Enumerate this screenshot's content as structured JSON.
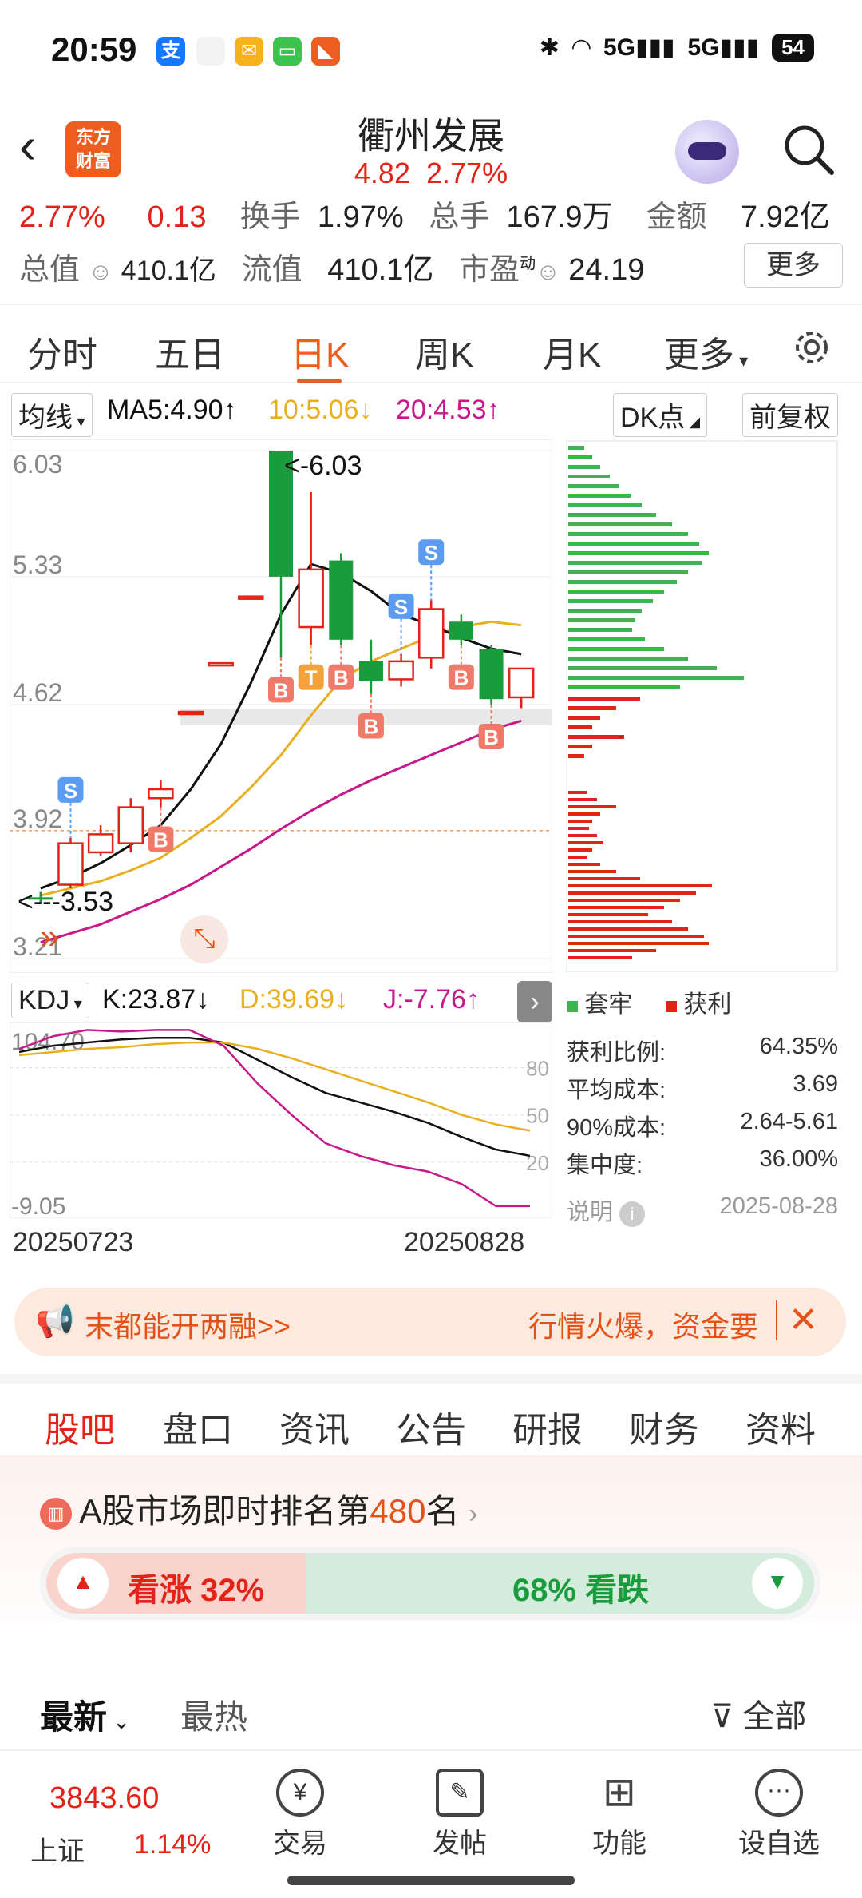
{
  "status_bar": {
    "time": "20:59",
    "network": "5G",
    "battery": "54"
  },
  "header": {
    "stock_name": "衢州发展",
    "price": "4.82",
    "change_pct": "2.77%"
  },
  "quote": {
    "row1": {
      "change_pct": "2.77%",
      "change": "0.13",
      "turnover_label": "换手",
      "turnover": "1.97%",
      "volume_label": "总手",
      "volume": "167.9万",
      "amount_label": "金额",
      "amount": "7.92亿"
    },
    "row2": {
      "total_cap_label": "总值",
      "total_cap": "410.1亿",
      "float_cap_label": "流值",
      "float_cap": "410.1亿",
      "pe_label": "市盈",
      "pe_sup": "动",
      "pe": "24.19"
    },
    "more_button": "更多"
  },
  "chart_tabs": [
    "分时",
    "五日",
    "日K",
    "周K",
    "月K",
    "更多"
  ],
  "chart_settings_icon": "gear-icon",
  "ma": {
    "label": "均线",
    "ma5": "MA5:4.90",
    "ma10": "10:5.06",
    "ma20": "20:4.53",
    "dk": "DK点",
    "adjust": "前复权"
  },
  "kdj": {
    "label": "KDJ",
    "k": "K:23.87",
    "d": "D:39.69",
    "j": "J:-7.76"
  },
  "colors": {
    "up": "#e2231a",
    "down": "#1a9c3c",
    "accent": "#ee5d20",
    "ma5": "#111111",
    "ma10": "#e8b020",
    "ma20": "#c8198a"
  },
  "chart_data": [
    {
      "type": "candlestick",
      "y_labels": [
        "6.03",
        "5.33",
        "4.62",
        "3.92",
        "3.21"
      ],
      "ylim": [
        3.21,
        6.03
      ],
      "annotations": {
        "high": "<-6.03",
        "low": "<---3.53"
      },
      "start_date": "20250723",
      "end_date": "20250828",
      "candles": [
        {
          "o": 3.55,
          "c": 3.55,
          "h": 3.58,
          "l": 3.52,
          "up": false
        },
        {
          "o": 3.62,
          "c": 3.85,
          "h": 3.88,
          "l": 3.6,
          "up": true
        },
        {
          "o": 3.8,
          "c": 3.9,
          "h": 3.95,
          "l": 3.78,
          "up": true
        },
        {
          "o": 3.85,
          "c": 4.05,
          "h": 4.1,
          "l": 3.8,
          "up": true
        },
        {
          "o": 4.1,
          "c": 4.15,
          "h": 4.2,
          "l": 4.05,
          "up": true
        },
        {
          "o": 4.58,
          "c": 4.58,
          "h": 4.58,
          "l": 4.58,
          "up": true
        },
        {
          "o": 4.85,
          "c": 4.85,
          "h": 4.85,
          "l": 4.85,
          "up": true
        },
        {
          "o": 5.22,
          "c": 5.22,
          "h": 5.22,
          "l": 5.22,
          "up": true
        },
        {
          "o": 6.03,
          "c": 5.33,
          "h": 6.03,
          "l": 4.88,
          "up": false
        },
        {
          "o": 5.05,
          "c": 5.37,
          "h": 5.8,
          "l": 4.95,
          "up": true
        },
        {
          "o": 5.42,
          "c": 4.98,
          "h": 5.46,
          "l": 4.95,
          "up": false
        },
        {
          "o": 4.75,
          "c": 4.86,
          "h": 4.98,
          "l": 4.68,
          "up": false
        },
        {
          "o": 4.76,
          "c": 4.86,
          "h": 4.9,
          "l": 4.72,
          "up": true
        },
        {
          "o": 4.88,
          "c": 5.15,
          "h": 5.2,
          "l": 4.82,
          "up": true
        },
        {
          "o": 5.08,
          "c": 4.98,
          "h": 5.12,
          "l": 4.95,
          "up": false
        },
        {
          "o": 4.93,
          "c": 4.65,
          "h": 4.95,
          "l": 4.62,
          "up": false
        },
        {
          "o": 4.66,
          "c": 4.82,
          "h": 4.82,
          "l": 4.6,
          "up": true
        }
      ],
      "signals": [
        {
          "i": 1,
          "label": "S"
        },
        {
          "i": 4,
          "label": "B"
        },
        {
          "i": 8,
          "label": "B"
        },
        {
          "i": 9,
          "label": "T"
        },
        {
          "i": 10,
          "label": "B"
        },
        {
          "i": 11,
          "label": "B"
        },
        {
          "i": 12,
          "label": "S"
        },
        {
          "i": 13,
          "label": "S"
        },
        {
          "i": 14,
          "label": "B"
        },
        {
          "i": 15,
          "label": "B"
        }
      ],
      "ma5": [
        3.6,
        3.66,
        3.74,
        3.84,
        3.95,
        4.15,
        4.4,
        4.74,
        5.12,
        5.4,
        5.35,
        5.25,
        5.12,
        5.06,
        4.99,
        4.93,
        4.9
      ],
      "ma10": [
        3.56,
        3.6,
        3.64,
        3.7,
        3.77,
        3.88,
        4.0,
        4.16,
        4.34,
        4.56,
        4.76,
        4.86,
        4.93,
        5.0,
        5.05,
        5.08,
        5.06
      ],
      "ma20": [
        3.3,
        3.35,
        3.4,
        3.47,
        3.54,
        3.62,
        3.72,
        3.82,
        3.93,
        4.03,
        4.12,
        4.2,
        4.27,
        4.34,
        4.41,
        4.48,
        4.53
      ]
    },
    {
      "type": "line",
      "title": "KDJ",
      "y_labels": [
        "104.70",
        "80",
        "50",
        "20",
        "-9.05"
      ],
      "ylim": [
        -9.05,
        104.7
      ],
      "series": [
        {
          "name": "K",
          "values": [
            90,
            94,
            96,
            98,
            99,
            99,
            96,
            85,
            74,
            64,
            58,
            52,
            45,
            36,
            28,
            24
          ]
        },
        {
          "name": "D",
          "values": [
            88,
            90,
            92,
            93,
            95,
            96,
            96,
            92,
            86,
            79,
            72,
            65,
            58,
            50,
            44,
            40
          ]
        },
        {
          "name": "J",
          "values": [
            92,
            100,
            104,
            103,
            104,
            104,
            94,
            70,
            50,
            32,
            24,
            18,
            14,
            6,
            -8,
            -8
          ]
        }
      ]
    }
  ],
  "chip": {
    "legend_hold": "套牢",
    "legend_profit": "获利",
    "rows": [
      {
        "label": "获利比例:",
        "value": "64.35%"
      },
      {
        "label": "平均成本:",
        "value": "3.69"
      },
      {
        "label": "90%成本:",
        "value": "2.64-5.61"
      },
      {
        "label": "集中度:",
        "value": "36.00%"
      }
    ],
    "note": "说明",
    "date": "2025-08-28"
  },
  "banner": {
    "left": "末都能开两融>>",
    "right": "行情火爆，资金要"
  },
  "section_tabs": [
    "股吧",
    "盘口",
    "资讯",
    "公告",
    "研报",
    "财务",
    "资料"
  ],
  "ranking": {
    "prefix": "A股市场即时排名第",
    "rank": "480",
    "suffix": "名"
  },
  "vote": {
    "bull": "看涨 32%",
    "bear": "68% 看跌",
    "bull_fraction": 0.32
  },
  "sort": {
    "latest": "最新",
    "hot": "最热",
    "filter": "全部"
  },
  "bottom_nav": {
    "index_value": "3843.60",
    "index_name": "上证",
    "index_change": "1.14%",
    "items": [
      "交易",
      "发帖",
      "功能",
      "设自选"
    ]
  }
}
